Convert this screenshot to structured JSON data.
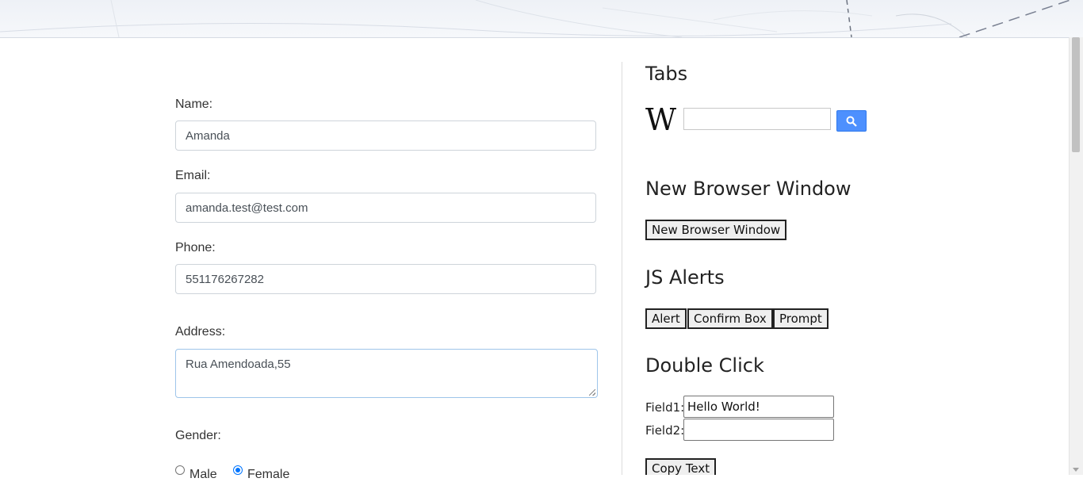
{
  "form": {
    "name_label": "Name:",
    "name_value": "Amanda",
    "email_label": "Email:",
    "email_value": "amanda.test@test.com",
    "phone_label": "Phone:",
    "phone_value": "551176267282",
    "address_label": "Address:",
    "address_value": "Rua Amendoada,55",
    "gender_label": "Gender:",
    "gender_options": [
      {
        "label": "Male",
        "checked": false
      },
      {
        "label": "Female",
        "checked": true
      }
    ]
  },
  "tabs": {
    "title": "Tabs",
    "wiki_logo": "W",
    "search_icon": "search-icon",
    "search_button_color": "#4d90fe"
  },
  "new_window": {
    "title": "New Browser Window",
    "button_label": "New Browser Window"
  },
  "alerts": {
    "title": "JS Alerts",
    "alert_label": "Alert",
    "confirm_label": "Confirm Box",
    "prompt_label": "Prompt"
  },
  "double_click": {
    "title": "Double Click",
    "field1_label": "Field1:",
    "field1_value": "Hello World!",
    "field2_label": "Field2:",
    "field2_value": "",
    "copy_button_label": "Copy Text"
  }
}
